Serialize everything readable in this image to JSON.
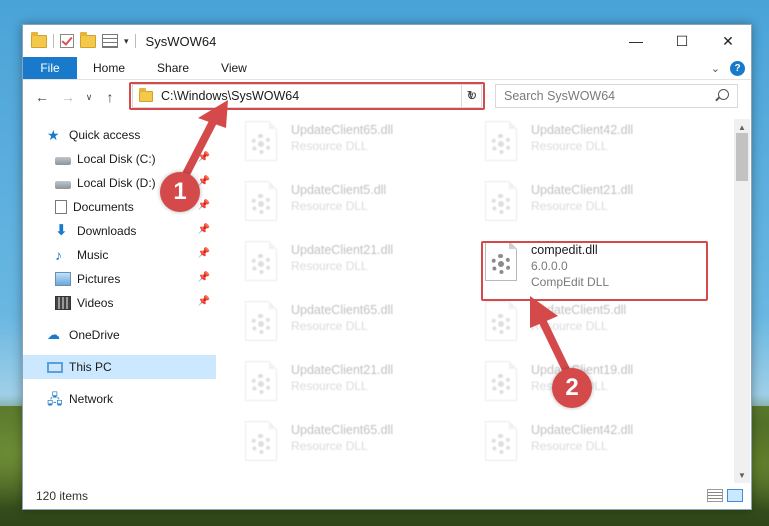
{
  "window": {
    "title": "SysWOW64",
    "minimize": "—",
    "maximize": "☐",
    "close": "✕"
  },
  "ribbon": {
    "tabs": [
      "File",
      "Home",
      "Share",
      "View"
    ],
    "help": "?"
  },
  "navigation": {
    "back": "←",
    "forward": "→",
    "recent": "∨",
    "up": "↑",
    "address_path": "C:\\Windows\\SysWOW64",
    "refresh": "↻",
    "search_placeholder": "Search SysWOW64"
  },
  "sidebar": {
    "items": [
      {
        "label": "Quick access"
      },
      {
        "label": "Local Disk (C:)"
      },
      {
        "label": "Local Disk (D:)"
      },
      {
        "label": "Documents"
      },
      {
        "label": "Downloads"
      },
      {
        "label": "Music"
      },
      {
        "label": "Pictures"
      },
      {
        "label": "Videos"
      },
      {
        "label": "OneDrive"
      },
      {
        "label": "This PC"
      },
      {
        "label": "Network"
      }
    ]
  },
  "files": [
    {
      "name": "UpdateClient65.dll",
      "desc": "Resource DLL"
    },
    {
      "name": "UpdateClient42.dll",
      "desc": "Resource DLL"
    },
    {
      "name": "UpdateClient5.dll",
      "desc": "Resource DLL"
    },
    {
      "name": "UpdateClient21.dll",
      "desc": "Resource DLL"
    },
    {
      "name": "UpdateClient21.dll",
      "desc": "Resource DLL"
    },
    {
      "name": "compedit.dll",
      "version": "6.0.0.0",
      "desc": "CompEdit DLL"
    },
    {
      "name": "UpdateClient65.dll",
      "desc": "Resource DLL"
    },
    {
      "name": "UpdateClient5.dll",
      "desc": "Resource DLL"
    },
    {
      "name": "UpdateClient21.dll",
      "desc": "Resource DLL"
    },
    {
      "name": "UpdateClient19.dll",
      "desc": "Resource DLL"
    },
    {
      "name": "UpdateClient65.dll",
      "desc": "Resource DLL"
    },
    {
      "name": "UpdateClient42.dll",
      "desc": "Resource DLL"
    }
  ],
  "status": {
    "item_count": "120 items"
  },
  "callouts": {
    "step1": "1",
    "step2": "2",
    "color": "#d44a4a"
  }
}
